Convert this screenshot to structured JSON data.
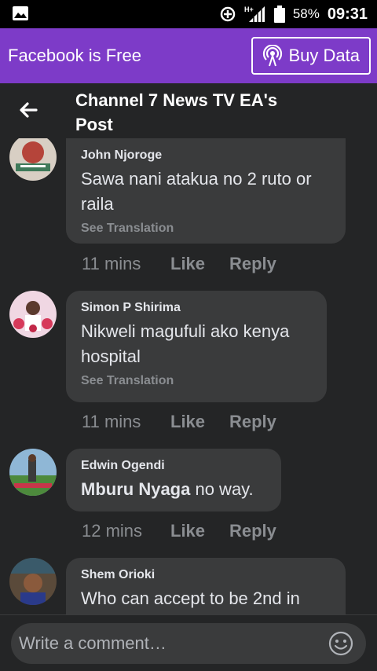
{
  "status_bar": {
    "left_icon": "image-icon",
    "icons": [
      "data-saver-icon",
      "hplus-signal-icon",
      "battery-icon"
    ],
    "network": "H+",
    "battery": "58%",
    "time": "09:31"
  },
  "promo": {
    "text": "Facebook is Free",
    "button_label": "Buy Data",
    "button_icon": "broadcast-icon"
  },
  "header": {
    "back_icon": "back-arrow-icon",
    "title": "Channel 7 News TV EA's Post"
  },
  "comments": [
    {
      "author": "John Njoroge",
      "text": "Sawa nani atakua no 2 ruto or raila",
      "see_translation": "See Translation",
      "time": "11 mins",
      "like": "Like",
      "reply": "Reply"
    },
    {
      "author": "Simon P Shirima",
      "text": "Nikweli magufuli ako kenya hospital",
      "see_translation": "See Translation",
      "time": "11 mins",
      "like": "Like",
      "reply": "Reply"
    },
    {
      "author": "Edwin Ogendi",
      "mention": "Mburu Nyaga",
      "text": " no way.",
      "time": "12 mins",
      "like": "Like",
      "reply": "Reply"
    },
    {
      "author": "Shem Orioki",
      "text": "Who can accept to be 2nd in"
    }
  ],
  "composer": {
    "placeholder": "Write a comment…",
    "emoji_icon": "smiley-icon"
  },
  "colors": {
    "promo_purple": "#7d3bc8",
    "background": "#242526",
    "bubble": "#3a3b3c",
    "muted_text": "#8a8d91"
  }
}
